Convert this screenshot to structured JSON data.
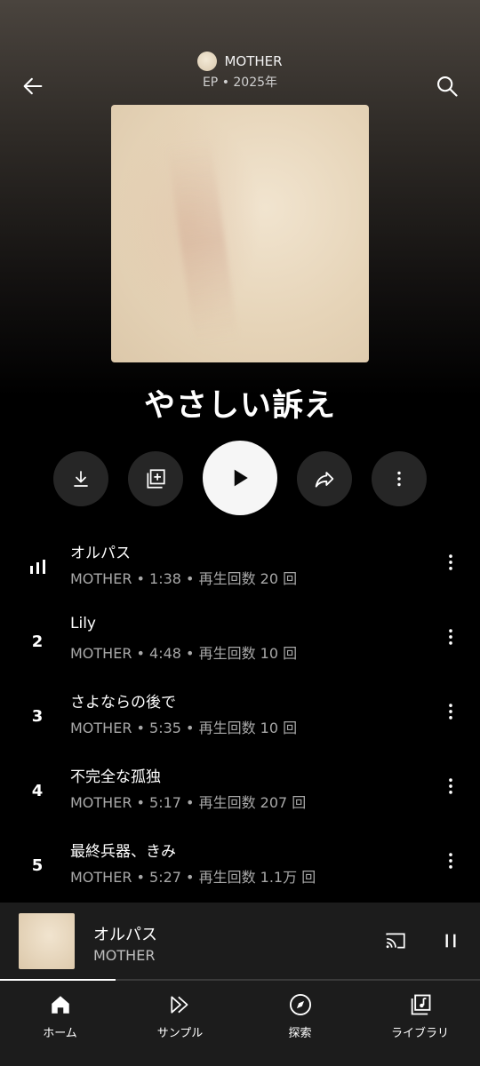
{
  "header": {
    "artist": "MOTHER",
    "subtitle": "EP • 2025年"
  },
  "album": {
    "title": "やさしい訴え"
  },
  "actions": {
    "download_icon": "download-icon",
    "save_icon": "add-to-library-icon",
    "play_icon": "play-icon",
    "share_icon": "share-icon",
    "more_icon": "more-vert-icon"
  },
  "tracks": [
    {
      "num": "",
      "playing": true,
      "title": "オルパス",
      "meta": "MOTHER • 1:38 • 再生回数 20 回"
    },
    {
      "num": "2",
      "playing": false,
      "title": "Lily",
      "meta": "MOTHER • 4:48 • 再生回数 10 回"
    },
    {
      "num": "3",
      "playing": false,
      "title": "さよならの後で",
      "meta": "MOTHER • 5:35 • 再生回数 10 回"
    },
    {
      "num": "4",
      "playing": false,
      "title": "不完全な孤独",
      "meta": "MOTHER • 5:17 • 再生回数 207 回"
    },
    {
      "num": "5",
      "playing": false,
      "title": "最終兵器、きみ",
      "meta": "MOTHER • 5:27 • 再生回数 1.1万 回"
    }
  ],
  "now_playing": {
    "title": "オルパス",
    "artist": "MOTHER",
    "progress": 0.24
  },
  "nav": [
    {
      "label": "ホーム",
      "icon": "home-icon",
      "active": true
    },
    {
      "label": "サンプル",
      "icon": "samples-icon",
      "active": false
    },
    {
      "label": "探索",
      "icon": "explore-icon",
      "active": false
    },
    {
      "label": "ライブラリ",
      "icon": "library-icon",
      "active": false
    }
  ],
  "colors": {
    "background": "#000000",
    "surface": "#1c1c1c",
    "play_button": "#f6f6f6",
    "secondary_text": "#a8a8a8"
  }
}
